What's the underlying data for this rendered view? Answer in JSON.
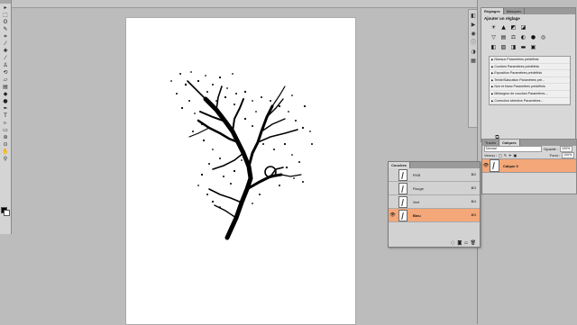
{
  "tools": {
    "items": [
      {
        "name": "move-tool-icon",
        "glyph": "▸"
      },
      {
        "name": "marquee-tool-icon",
        "glyph": "⬚"
      },
      {
        "name": "lasso-tool-icon",
        "glyph": "ʘ"
      },
      {
        "name": "quick-select-tool-icon",
        "glyph": "✎"
      },
      {
        "name": "crop-tool-icon",
        "glyph": "⌗"
      },
      {
        "name": "eyedropper-tool-icon",
        "glyph": "⁄"
      },
      {
        "name": "healing-brush-tool-icon",
        "glyph": "✚"
      },
      {
        "name": "brush-tool-icon",
        "glyph": "⁄"
      },
      {
        "name": "clone-stamp-tool-icon",
        "glyph": "♙"
      },
      {
        "name": "history-brush-tool-icon",
        "glyph": "⟲"
      },
      {
        "name": "eraser-tool-icon",
        "glyph": "▱"
      },
      {
        "name": "gradient-tool-icon",
        "glyph": "▤"
      },
      {
        "name": "blur-tool-icon",
        "glyph": "◆"
      },
      {
        "name": "dodge-tool-icon",
        "glyph": "●"
      },
      {
        "name": "pen-tool-icon",
        "glyph": "✒"
      },
      {
        "name": "type-tool-icon",
        "glyph": "T"
      },
      {
        "name": "path-select-tool-icon",
        "glyph": "▹"
      },
      {
        "name": "shape-tool-icon",
        "glyph": "▭"
      },
      {
        "name": "3d-rotate-tool-icon",
        "glyph": "⊛"
      },
      {
        "name": "3d-orbit-tool-icon",
        "glyph": "⊙"
      },
      {
        "name": "hand-tool-icon",
        "glyph": "✋"
      },
      {
        "name": "zoom-tool-icon",
        "glyph": "⚲"
      }
    ],
    "foreground_color": "#000000",
    "background_color": "#ffffff"
  },
  "adjustments": {
    "tabs": [
      "Réglages",
      "Masques"
    ],
    "title": "Ajouter un réglage",
    "icons": [
      "brightness-icon",
      "levels-icon",
      "curves-icon",
      "exposure-icon",
      "vibrance-icon",
      "hue-saturation-icon",
      "color-balance-icon",
      "black-white-icon",
      "photo-filter-icon",
      "channel-mixer-icon",
      "invert-icon",
      "posterize-icon",
      "threshold-icon",
      "gradient-map-icon",
      "selective-color-icon"
    ],
    "presets": [
      "Niveaux Paramètres prédéfinis",
      "Courbes Paramètres prédéfinis",
      "Exposition Paramètres prédéfinis",
      "Teinte/Saturation Paramètres pré...",
      "Noir et blanc Paramètres prédéfinis",
      "Mélangeur de couches Paramètres ...",
      "Correction sélective Paramètres..."
    ]
  },
  "layers": {
    "tabs": [
      "Tracés",
      "Calques"
    ],
    "blend_mode": "Normal",
    "opacity_label": "Opacité :",
    "opacity_value": "100%",
    "lock_label": "Verrou :",
    "fill_label": "Fond :",
    "fill_value": "100%",
    "items": [
      {
        "name": "Calque 0",
        "visible": true,
        "selected": true
      }
    ],
    "selected_color": "#f4a778"
  },
  "channels": {
    "tab": "Couches",
    "items": [
      {
        "name": "RVB",
        "shortcut": "⌘2",
        "visible": false
      },
      {
        "name": "Rouge",
        "shortcut": "⌘3",
        "visible": false
      },
      {
        "name": "Vert",
        "shortcut": "⌘4",
        "visible": false
      },
      {
        "name": "Bleu",
        "shortcut": "⌘5",
        "visible": true,
        "selected": true
      }
    ]
  }
}
